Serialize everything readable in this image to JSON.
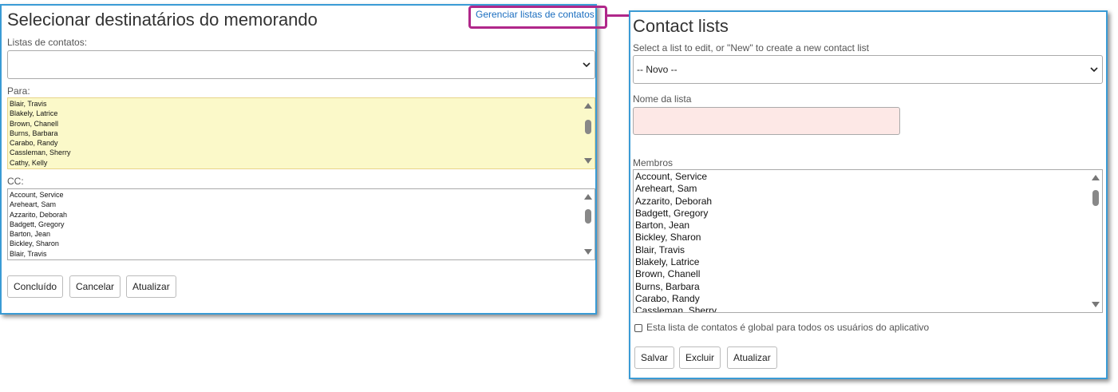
{
  "memo": {
    "title": "Selecionar destinatários do memorando",
    "manage_link": "Gerenciar listas de contatos",
    "contact_lists_label": "Listas de contatos:",
    "contact_lists_value": "",
    "to_label": "Para:",
    "to_items": [
      "Blair, Travis",
      "Blakely, Latrice",
      "Brown, Chanell",
      "Burns, Barbara",
      "Carabo, Randy",
      "Cassleman, Sherry",
      "Cathy, Kelly"
    ],
    "cc_label": "CC:",
    "cc_items": [
      "Account, Service",
      "Areheart, Sam",
      "Azzarito, Deborah",
      "Badgett, Gregory",
      "Barton, Jean",
      "Bickley, Sharon",
      "Blair, Travis"
    ],
    "done_label": "Concluído",
    "cancel_label": "Cancelar",
    "update_label": "Atualizar"
  },
  "contacts": {
    "title": "Contact lists",
    "select_label": "Select a list to edit, or \"New\" to create a new contact list",
    "select_value": "-- Novo --",
    "name_label": "Nome da lista",
    "name_value": "",
    "members_label": "Membros",
    "members": [
      "Account, Service",
      "Areheart, Sam",
      "Azzarito, Deborah",
      "Badgett, Gregory",
      "Barton, Jean",
      "Bickley, Sharon",
      "Blair, Travis",
      "Blakely, Latrice",
      "Brown, Chanell",
      "Burns, Barbara",
      "Carabo, Randy",
      "Cassleman, Sherry"
    ],
    "global_label": "Esta lista de contatos é global para todos os usuários do aplicativo",
    "global_checked": false,
    "save_label": "Salvar",
    "delete_label": "Excluir",
    "update_label": "Atualizar"
  },
  "colors": {
    "panel_border": "#3a9bd5",
    "highlight": "#b0278a",
    "to_list_bg": "#fbf9c9",
    "name_input_bg": "#fde8e6",
    "link": "#1a6dbf"
  }
}
